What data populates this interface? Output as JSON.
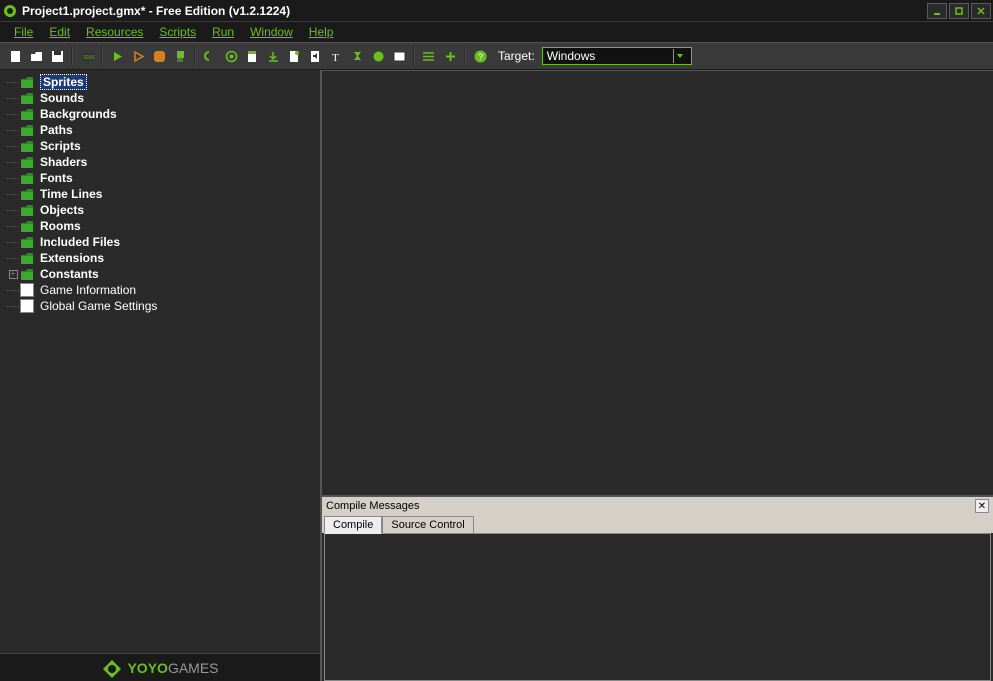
{
  "window": {
    "title": "Project1.project.gmx*  -  Free Edition (v1.2.1224)"
  },
  "menu": {
    "items": [
      "File",
      "Edit",
      "Resources",
      "Scripts",
      "Run",
      "Window",
      "Help"
    ]
  },
  "toolbar": {
    "target_label": "Target:",
    "target_value": "Windows"
  },
  "tree": {
    "items": [
      {
        "label": "Sprites",
        "type": "folder",
        "selected": true,
        "bold": true
      },
      {
        "label": "Sounds",
        "type": "folder",
        "bold": true
      },
      {
        "label": "Backgrounds",
        "type": "folder",
        "bold": true
      },
      {
        "label": "Paths",
        "type": "folder",
        "bold": true
      },
      {
        "label": "Scripts",
        "type": "folder",
        "bold": true
      },
      {
        "label": "Shaders",
        "type": "folder",
        "bold": true
      },
      {
        "label": "Fonts",
        "type": "folder",
        "bold": true
      },
      {
        "label": "Time Lines",
        "type": "folder",
        "bold": true
      },
      {
        "label": "Objects",
        "type": "folder",
        "bold": true
      },
      {
        "label": "Rooms",
        "type": "folder",
        "bold": true
      },
      {
        "label": "Included Files",
        "type": "folder",
        "bold": true
      },
      {
        "label": "Extensions",
        "type": "folder",
        "bold": true
      },
      {
        "label": "Constants",
        "type": "folder",
        "bold": true,
        "expandable": true
      },
      {
        "label": "Game Information",
        "type": "file"
      },
      {
        "label": "Global Game Settings",
        "type": "file"
      }
    ]
  },
  "logo": {
    "brand": "YOYO",
    "suffix": "GAMES"
  },
  "compile": {
    "title": "Compile Messages",
    "tabs": [
      "Compile",
      "Source Control"
    ],
    "active_tab": 0
  }
}
